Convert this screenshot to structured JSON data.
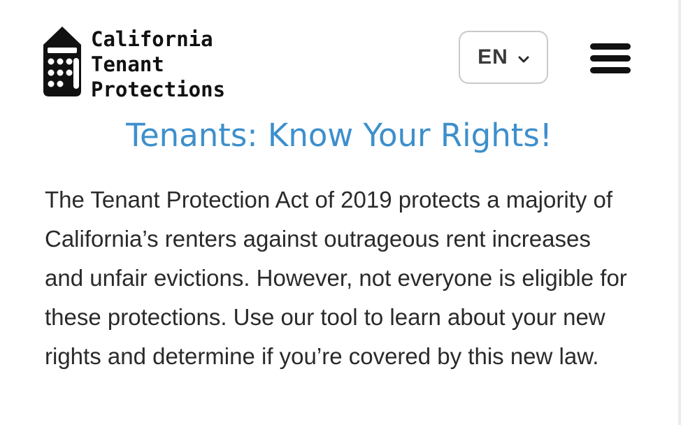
{
  "header": {
    "logo": {
      "icon": "building-icon",
      "lines": [
        "California",
        "Tenant",
        "Protections"
      ]
    },
    "language_select": {
      "value": "EN",
      "icon": "chevron-down-icon"
    },
    "menu": {
      "icon": "hamburger-menu-icon"
    }
  },
  "main": {
    "headline": "Tenants: Know Your Rights!",
    "intro": "The Tenant Protection Act of 2019 protects a majority of California’s renters against outrageous rent increases and unfair evictions. However, not everyone is eligible for these protections. Use our tool to learn about your new rights and determine if you’re covered by this new law."
  },
  "colors": {
    "headline": "#3d8fcc",
    "logo": "#111111",
    "body_text": "#2a2a2a",
    "select_border": "#c9c9c9"
  }
}
